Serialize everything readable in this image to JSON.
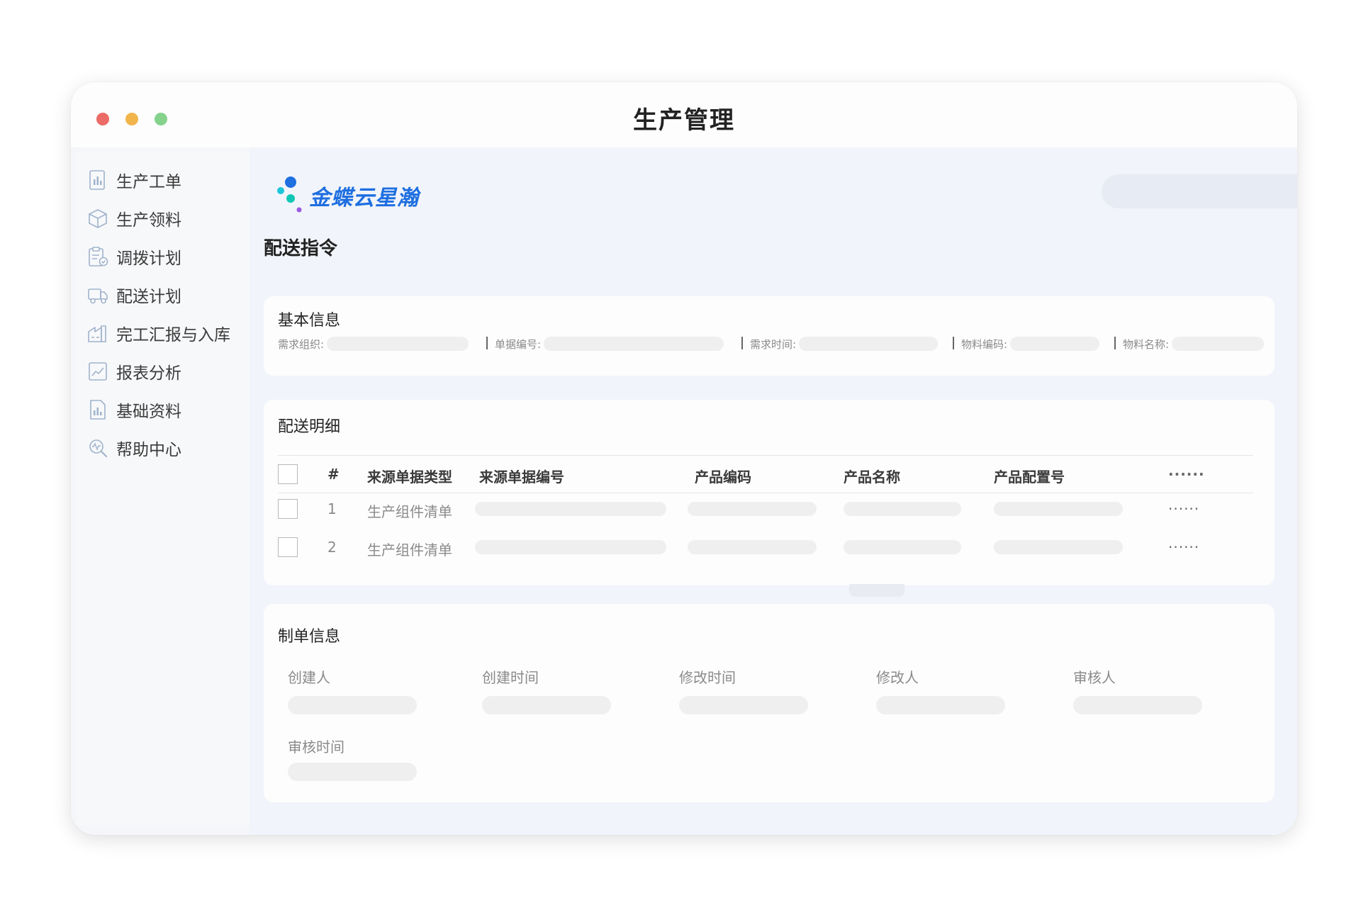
{
  "window": {
    "title": "生产管理"
  },
  "sidebar": {
    "items": [
      {
        "label": "生产工单",
        "icon": "work-order-icon"
      },
      {
        "label": "生产领料",
        "icon": "box-icon"
      },
      {
        "label": "调拨计划",
        "icon": "clipboard-check-icon"
      },
      {
        "label": "配送计划",
        "icon": "truck-icon"
      },
      {
        "label": "完工汇报与入库",
        "icon": "warehouse-icon"
      },
      {
        "label": "报表分析",
        "icon": "line-chart-icon"
      },
      {
        "label": "基础资料",
        "icon": "document-chart-icon"
      },
      {
        "label": "帮助中心",
        "icon": "help-search-icon"
      }
    ]
  },
  "header": {
    "brand": "金蝶云星瀚",
    "search_icon": "search-icon"
  },
  "page": {
    "title": "配送指令"
  },
  "basic_info": {
    "title": "基本信息",
    "fields": [
      {
        "label": "需求组织:"
      },
      {
        "label": "单据编号:"
      },
      {
        "label": "需求时间:"
      },
      {
        "label": "物料编码:"
      },
      {
        "label": "物料名称:"
      }
    ],
    "separator": "|"
  },
  "detail": {
    "title": "配送明细",
    "columns": [
      "#",
      "来源单据类型",
      "来源单据编号",
      "产品编码",
      "产品名称",
      "产品配置号",
      "······"
    ],
    "rows": [
      {
        "index": "1",
        "source_type": "生产组件清单",
        "more": "······"
      },
      {
        "index": "2",
        "source_type": "生产组件清单",
        "more": "······"
      }
    ]
  },
  "maker_info": {
    "title": "制单信息",
    "fields": [
      "创建人",
      "创建时间",
      "修改时间",
      "修改人",
      "审核人",
      "审核时间"
    ]
  },
  "colors": {
    "accent": "#1e6fe0",
    "dot_red": "#ec6b66",
    "dot_yellow": "#f1b54c",
    "dot_green": "#84d28c",
    "content_bg": "#f1f4fa",
    "placeholder_bar": "#efefef"
  }
}
